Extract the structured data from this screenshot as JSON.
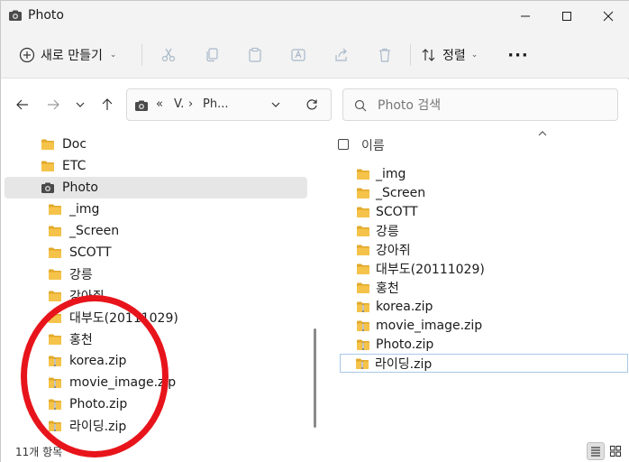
{
  "window": {
    "title": "Photo"
  },
  "commandbar": {
    "new_label": "새로 만들기",
    "sort_label": "정렬"
  },
  "address": {
    "overflow": "«",
    "seg1": "V.",
    "separator": "›",
    "seg2": "Ph..."
  },
  "search": {
    "placeholder": "Photo 검색"
  },
  "nav": {
    "items": [
      {
        "label": "Doc",
        "icon": "folder-icon"
      },
      {
        "label": "ETC",
        "icon": "folder-icon"
      },
      {
        "label": "Photo",
        "icon": "camera-icon",
        "selected": true
      },
      {
        "label": "_img",
        "icon": "folder-icon"
      },
      {
        "label": "_Screen",
        "icon": "folder-icon"
      },
      {
        "label": "SCOTT",
        "icon": "folder-icon"
      },
      {
        "label": "강릉",
        "icon": "folder-icon"
      },
      {
        "label": "강아쥐",
        "icon": "folder-icon"
      },
      {
        "label": "대부도(20111029)",
        "icon": "folder-icon"
      },
      {
        "label": "홍천",
        "icon": "folder-icon"
      },
      {
        "label": "korea.zip",
        "icon": "zip-folder-icon"
      },
      {
        "label": "movie_image.zip",
        "icon": "zip-folder-icon"
      },
      {
        "label": "Photo.zip",
        "icon": "zip-folder-icon"
      },
      {
        "label": "라이딩.zip",
        "icon": "zip-folder-icon"
      }
    ]
  },
  "list": {
    "header_name": "이름",
    "items": [
      {
        "label": "_img",
        "icon": "folder-icon"
      },
      {
        "label": "_Screen",
        "icon": "folder-icon"
      },
      {
        "label": "SCOTT",
        "icon": "folder-icon"
      },
      {
        "label": "강릉",
        "icon": "folder-icon"
      },
      {
        "label": "강아쥐",
        "icon": "folder-icon"
      },
      {
        "label": "대부도(20111029)",
        "icon": "folder-icon"
      },
      {
        "label": "홍천",
        "icon": "folder-icon"
      },
      {
        "label": "korea.zip",
        "icon": "zip-folder-icon"
      },
      {
        "label": "movie_image.zip",
        "icon": "zip-folder-icon"
      },
      {
        "label": "Photo.zip",
        "icon": "zip-folder-icon"
      },
      {
        "label": "라이딩.zip",
        "icon": "zip-folder-icon",
        "focused": true
      }
    ]
  },
  "status": {
    "text": "11개 항목"
  },
  "colors": {
    "folder": "#f5c34a",
    "folder_dark": "#e2a92a",
    "annotation": "#e8141b",
    "accent": "#0067c0"
  }
}
